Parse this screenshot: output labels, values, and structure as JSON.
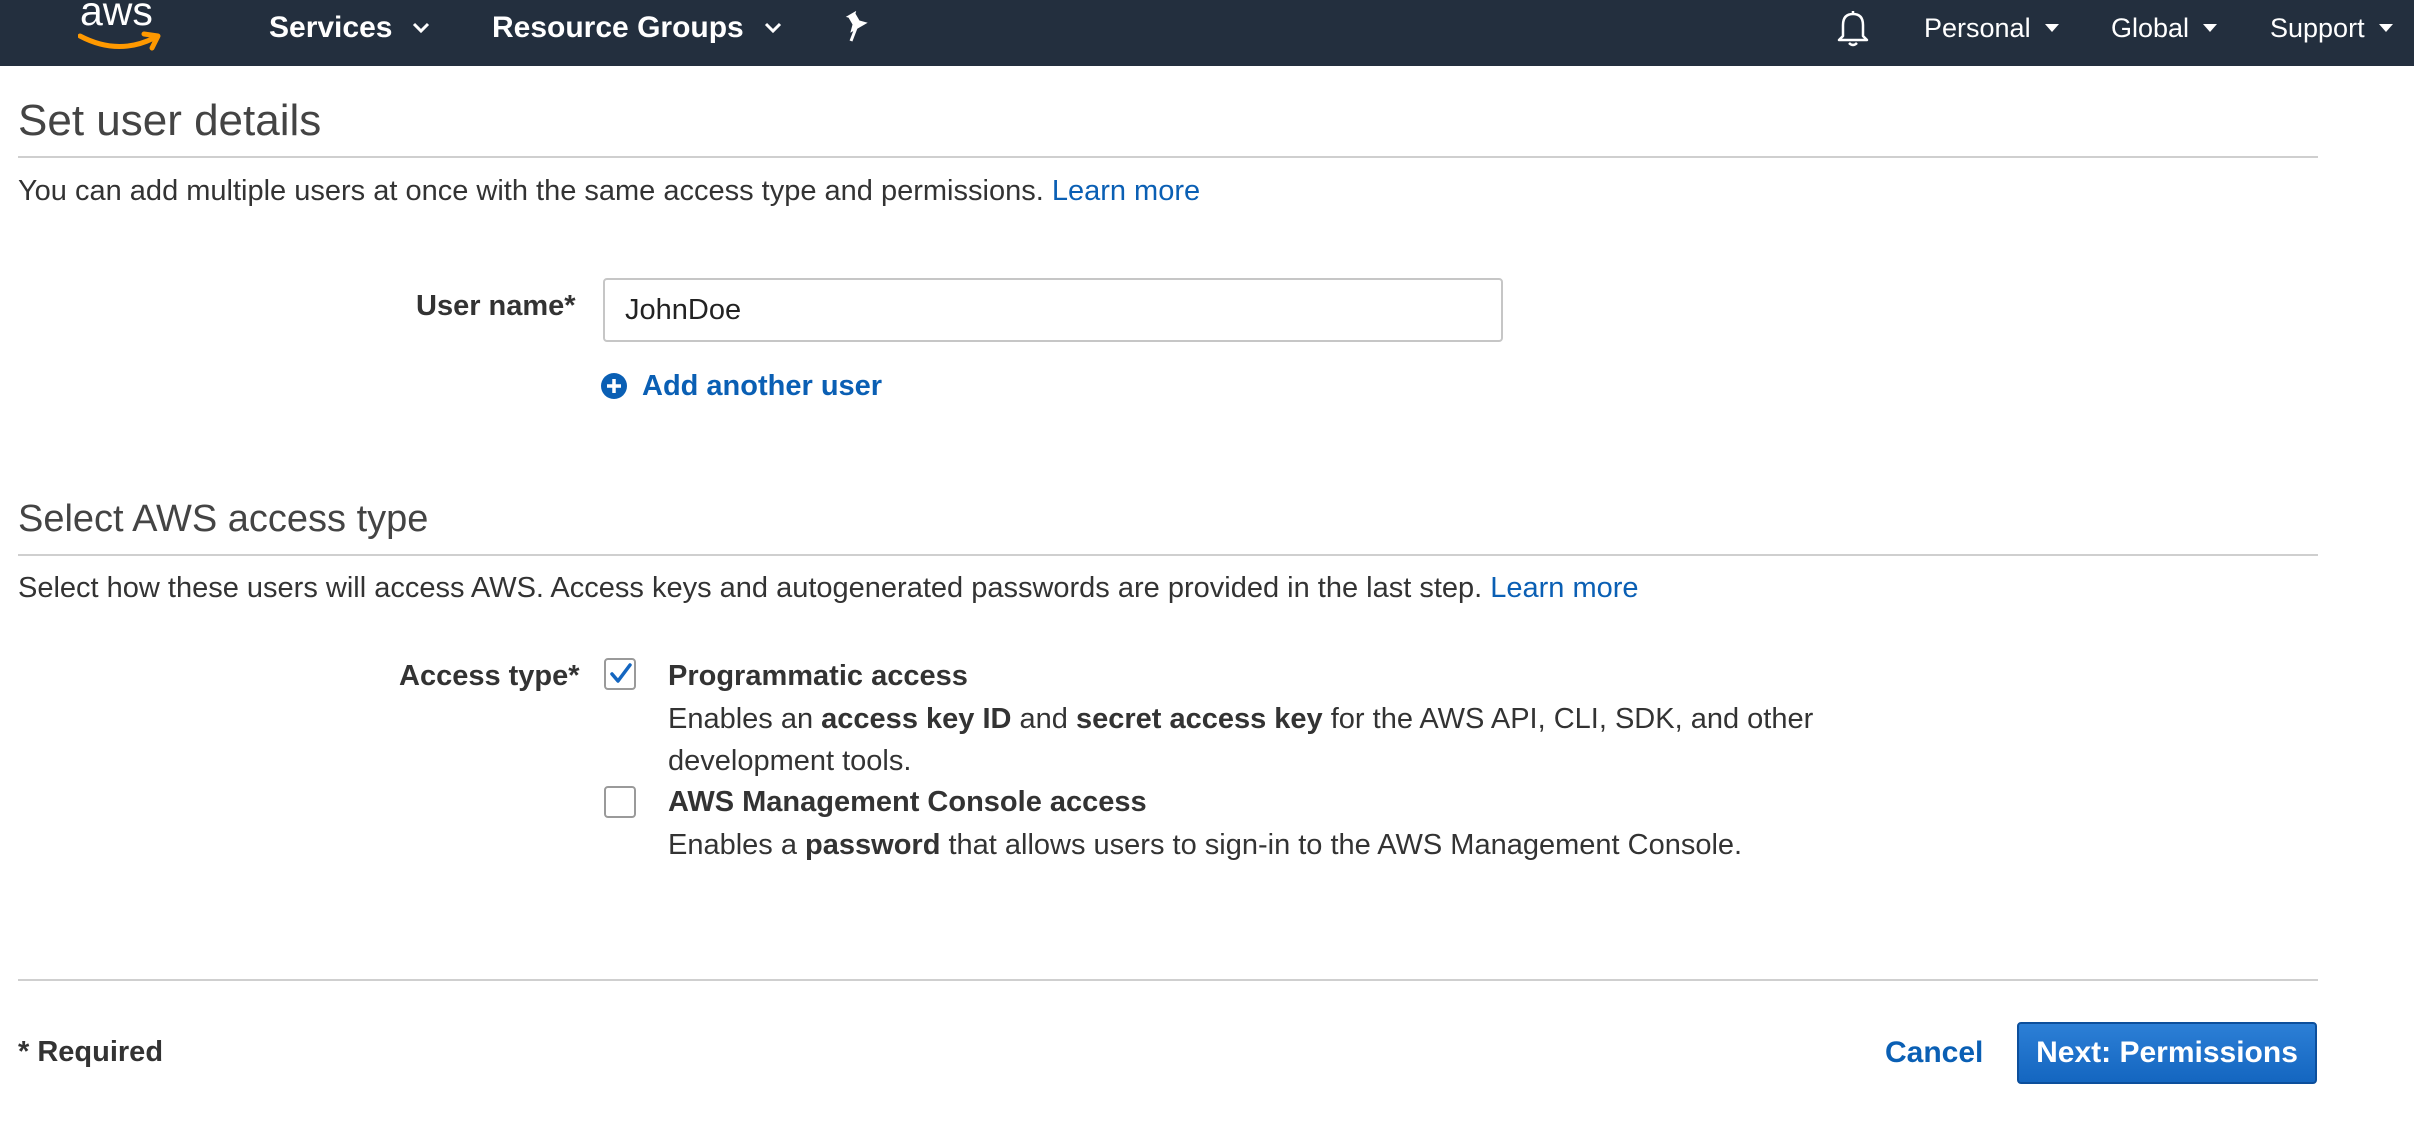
{
  "nav": {
    "logo_text": "aws",
    "services": "Services",
    "resource_groups": "Resource Groups",
    "account": "Personal",
    "region": "Global",
    "support": "Support"
  },
  "section1": {
    "title": "Set user details",
    "description": "You can add multiple users at once with the same access type and permissions.",
    "learn_more": "Learn more",
    "user_name_label": "User name*",
    "user_name_value": "JohnDoe",
    "add_another_user": "Add another user"
  },
  "section2": {
    "title": "Select AWS access type",
    "description": "Select how these users will access AWS. Access keys and autogenerated passwords are provided in the last step.",
    "learn_more": "Learn more",
    "access_type_label": "Access type*",
    "options": [
      {
        "title": "Programmatic access",
        "checked": true,
        "desc_parts": [
          "Enables an ",
          "access key ID",
          " and ",
          "secret access key",
          " for the AWS API, CLI, SDK, and other development tools."
        ]
      },
      {
        "title": "AWS Management Console access",
        "checked": false,
        "desc_parts": [
          "Enables a ",
          "password",
          " that allows users to sign-in to the AWS Management Console."
        ]
      }
    ]
  },
  "footer": {
    "required_note": "* Required",
    "cancel": "Cancel",
    "next": "Next: Permissions"
  },
  "colors": {
    "nav_bg": "#232f3e",
    "link": "#0a5fb4",
    "primary_button": "#1466c0",
    "aws_smile": "#ff9900"
  }
}
